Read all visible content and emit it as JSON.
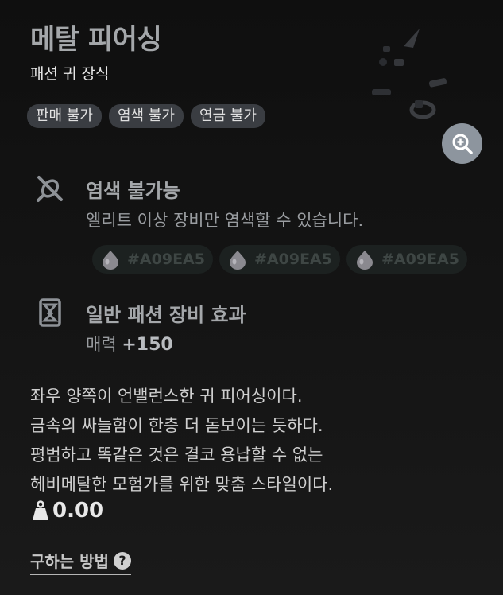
{
  "item": {
    "name": "메탈 피어싱",
    "category": "패션 귀 장식",
    "tags": [
      "판매 불가",
      "염색 불가",
      "연금 불가"
    ]
  },
  "dye": {
    "icon": "no-dye-icon",
    "title": "염색 불가능",
    "description": "엘리트 이상 장비만 염색할 수 있습니다.",
    "colors": [
      "#A09EA5",
      "#A09EA5",
      "#A09EA5"
    ]
  },
  "effect": {
    "icon": "fashion-effect-icon",
    "title": "일반 패션 장비 효과",
    "stat_label": "매력",
    "stat_value": "+150"
  },
  "flavor": [
    "좌우 양쪽이 언밸런스한 귀 피어싱이다.",
    "금속의 싸늘함이 한층 더 돋보이는 듯하다.",
    "평범하고 똑같은 것은 결코 용납할 수 없는",
    "헤비메탈한 모험가를 위한 맞춤 스타일이다."
  ],
  "weight": {
    "icon": "weight-icon",
    "value": "0.00"
  },
  "howto": {
    "label": "구하는 방법",
    "icon": "help-icon"
  },
  "zoom": {
    "icon": "zoom-in-icon"
  },
  "colors": {
    "accent_gray": "#a4a7aa",
    "tag_bg": "#3a3d42",
    "chip_bg": "#1c2120"
  }
}
